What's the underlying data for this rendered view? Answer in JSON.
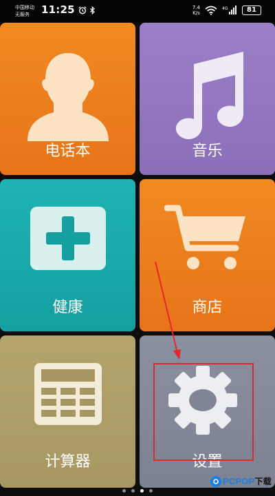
{
  "status_bar": {
    "carrier_line1": "中国移动",
    "carrier_line2": "无服务",
    "time": "11:25",
    "net_speed_value": "7.4",
    "net_speed_unit": "K/s",
    "battery": "81",
    "icons": [
      "alarm-icon",
      "bluetooth-icon",
      "wifi-icon",
      "signal-icon",
      "battery-icon"
    ]
  },
  "tiles": [
    {
      "label": "电话本",
      "icon": "contact-person-icon",
      "color": "#e77418"
    },
    {
      "label": "音乐",
      "icon": "music-note-icon",
      "color": "#8c6fba"
    },
    {
      "label": "健康",
      "icon": "medical-kit-icon",
      "color": "#159f9f"
    },
    {
      "label": "商店",
      "icon": "shopping-cart-icon",
      "color": "#e77418"
    },
    {
      "label": "计算器",
      "icon": "calculator-icon",
      "color": "#a89762"
    },
    {
      "label": "设置",
      "icon": "gear-icon",
      "color": "#7c8292"
    }
  ],
  "annotation": {
    "color": "#e3282a"
  },
  "page_indicator": {
    "pages": 4,
    "active": 3
  },
  "watermark": {
    "brand": "PCPOP",
    "suffix": "下载",
    "color": "#1a7fe0"
  }
}
